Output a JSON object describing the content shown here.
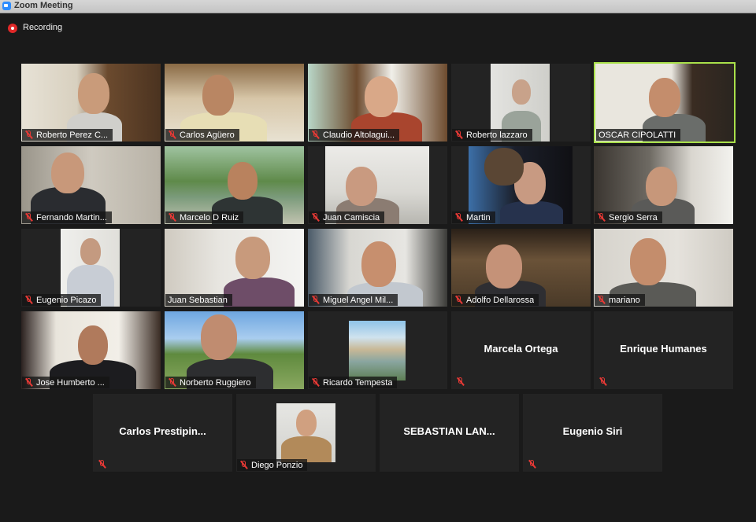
{
  "window": {
    "title": "Zoom Meeting"
  },
  "recording": {
    "label": "Recording",
    "color": "#e02828"
  },
  "active_speaker_color": "#a9e04a",
  "mute_icon": "microphone-muted-icon",
  "participants": [
    {
      "name": "Roberto Perez C..."
    },
    {
      "name": "Carlos Agüero"
    },
    {
      "name": "Claudio Altolagui..."
    },
    {
      "name": "Roberto lazzaro"
    },
    {
      "name": "OSCAR CIPOLATTI",
      "active_speaker": true
    },
    {
      "name": "Fernando Martin..."
    },
    {
      "name": "Marcelo D Ruiz"
    },
    {
      "name": "Juan Camiscia"
    },
    {
      "name": "Martin"
    },
    {
      "name": "Sergio Serra"
    },
    {
      "name": "Eugenio Picazo"
    },
    {
      "name": "Juan Sebastian"
    },
    {
      "name": "Miguel Angel Mil..."
    },
    {
      "name": "Adolfo Dellarossa"
    },
    {
      "name": "mariano"
    },
    {
      "name": "Jose Humberto ..."
    },
    {
      "name": "Norberto Ruggiero"
    },
    {
      "name": "Ricardo Tempesta"
    },
    {
      "name": "Marcela Ortega",
      "video": false
    },
    {
      "name": "Enrique Humanes",
      "video": false
    },
    {
      "name": "Carlos  Prestipin...",
      "video": false
    },
    {
      "name": "Diego Ponzio"
    },
    {
      "name": "SEBASTIAN  LAN...",
      "video": false
    },
    {
      "name": "Eugenio Siri",
      "video": false
    }
  ]
}
